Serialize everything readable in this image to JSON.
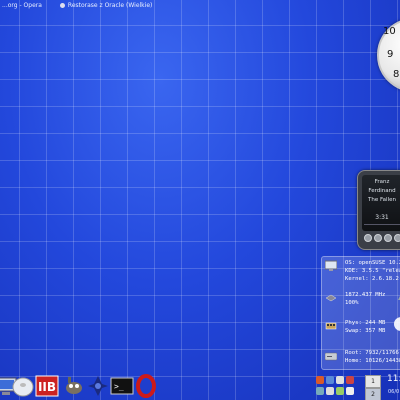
{
  "taskbar": {
    "titles": [
      {
        "label": "...org - Opera"
      },
      {
        "label": "Restorase z Oracle (Wielkie)"
      }
    ]
  },
  "clock_widget": {
    "numerals": [
      "10",
      "9",
      "8"
    ]
  },
  "media_player": {
    "artist": "Franz Ferdinand",
    "track": "The Fallen",
    "time": "3:31"
  },
  "sysinfo": {
    "os_line": "OS: openSUSE 10.2",
    "kde_line": "KDE: 3.5.5 \"release",
    "kernel_line": "Kernel: 2.6.18.2-",
    "cpu_freq": "1872.437 MHz",
    "cpu_load": "100%",
    "phys": "Phys: 244 MB",
    "swap": "Swap: 357 MB",
    "root": "Root: 7932/11766",
    "home": "Home: 10126/14438"
  },
  "dock": {
    "icons": [
      "computer-icon",
      "disk-icon",
      "mb-icon",
      "gimp-icon",
      "kde-icon",
      "terminal-icon",
      "opera-icon"
    ]
  },
  "tray": {
    "pager": [
      "1",
      "2"
    ],
    "clock_time": "11:",
    "clock_date": "06/0"
  },
  "colors": {
    "wallpaper": "#1c3fd6",
    "panel_text": "#ffffff",
    "opera_red": "#cc1a1a"
  }
}
